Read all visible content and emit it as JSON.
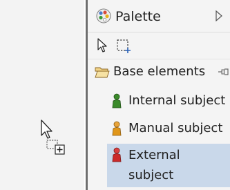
{
  "palette": {
    "title": "Palette",
    "title_icon": "palette-icon",
    "collapse_icon": "triangle-right-icon",
    "tools": [
      {
        "name": "select-tool",
        "icon": "arrow-cursor-icon"
      },
      {
        "name": "marquee-tool",
        "icon": "marquee-icon"
      }
    ],
    "drawer": {
      "label": "Base elements",
      "icon": "folder-open-icon",
      "pin_icon": "pin-icon"
    },
    "entries": [
      {
        "label": "Internal subject",
        "icon": "person-icon",
        "color": "#3a8a2a"
      },
      {
        "label": "Manual subject",
        "icon": "person-icon",
        "color": "#e0961a"
      },
      {
        "label": "External subject",
        "icon": "person-icon",
        "color": "#cc2a2a",
        "selected": true
      }
    ]
  },
  "canvas": {
    "cursor_icon": "arrow-cursor-icon",
    "drop_icon": "drop-add-icon"
  },
  "colors": {
    "selection": "#c9d8ea",
    "divider": "#6e6e6e",
    "background": "#f4f4f4"
  }
}
